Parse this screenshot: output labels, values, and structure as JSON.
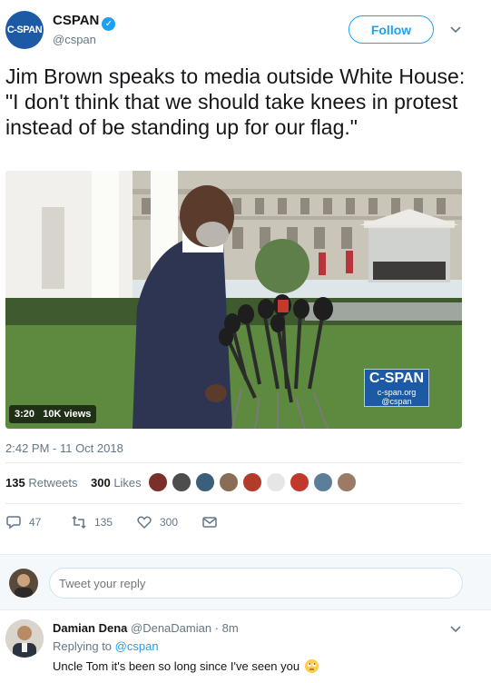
{
  "author": {
    "avatar_text": "C-SPAN",
    "name": "CSPAN",
    "handle": "@cspan",
    "verified_icon": "verified-badge-icon"
  },
  "follow_label": "Follow",
  "tweet_text": "Jim Brown speaks to media outside White House: \"I don't think that we should take knees in protest instead of be standing up for our flag.\"",
  "video": {
    "duration": "3:20",
    "views": "10K views",
    "watermark_big": "C-SPAN",
    "watermark_small1": "c-span.org",
    "watermark_small2": "@cspan"
  },
  "timestamp": "2:42 PM - 11 Oct 2018",
  "stats": {
    "retweets_count": "135",
    "retweets_label": "Retweets",
    "likes_count": "300",
    "likes_label": "Likes"
  },
  "actions": {
    "reply_count": "47",
    "retweet_count": "135",
    "like_count": "300"
  },
  "reply_box": {
    "placeholder": "Tweet your reply"
  },
  "reply": {
    "name": "Damian Dena",
    "handle": "@DenaDamian",
    "time": "· 8m",
    "replying_prefix": "Replying to",
    "replying_to": "@cspan",
    "text": "Uncle Tom it's been so long since I've seen you"
  },
  "colors": {
    "accent": "#1da1f2",
    "cspan_blue": "#1c5aa6",
    "muted": "#657786"
  }
}
